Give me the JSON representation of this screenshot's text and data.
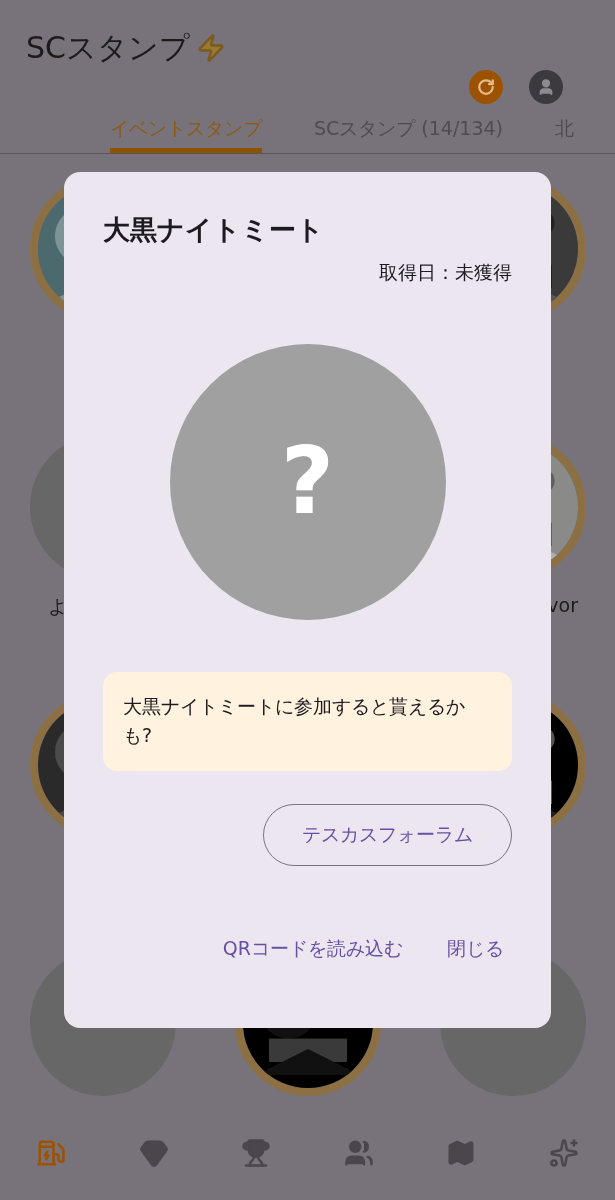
{
  "app_bar": {
    "title": "SCスタンプ",
    "actions": [
      {
        "kind": "refresh"
      },
      {
        "kind": "account"
      }
    ]
  },
  "tabs": [
    {
      "label": "イベントスタンプ",
      "selected": true
    },
    {
      "label": "SCスタンプ (14/134)",
      "selected": false
    },
    {
      "label": "北",
      "selected": false
    }
  ],
  "stamp_rows": [
    {
      "stamps": [
        {
          "acquired": true
        },
        {
          "acquired": true
        }
      ]
    },
    {
      "stamps": [
        {
          "acquired": false,
          "label": "よ"
        },
        {
          "acquired": true,
          "label": "vor"
        }
      ]
    },
    {
      "stamps": [
        {
          "acquired": true
        },
        {
          "acquired": true
        }
      ]
    },
    {
      "stamps": [
        {
          "acquired": false
        },
        {
          "acquired": true
        },
        {
          "acquired": false
        }
      ]
    }
  ],
  "dialog": {
    "title": "大黒ナイトミート",
    "date": "取得日：未獲得",
    "image_symbol": "?",
    "message": "大黒ナイトミートに参加すると貰えるかも?",
    "link_button": "テスカスフォーラム",
    "actions": [
      "QRコードを読み込む",
      "閉じる"
    ]
  },
  "bottom_nav": [
    {
      "kind": "charger",
      "selected": true
    },
    {
      "kind": "gem",
      "selected": false
    },
    {
      "kind": "trophy",
      "selected": false
    },
    {
      "kind": "people",
      "selected": false
    },
    {
      "kind": "map",
      "selected": false
    },
    {
      "kind": "trend",
      "selected": false
    }
  ]
}
